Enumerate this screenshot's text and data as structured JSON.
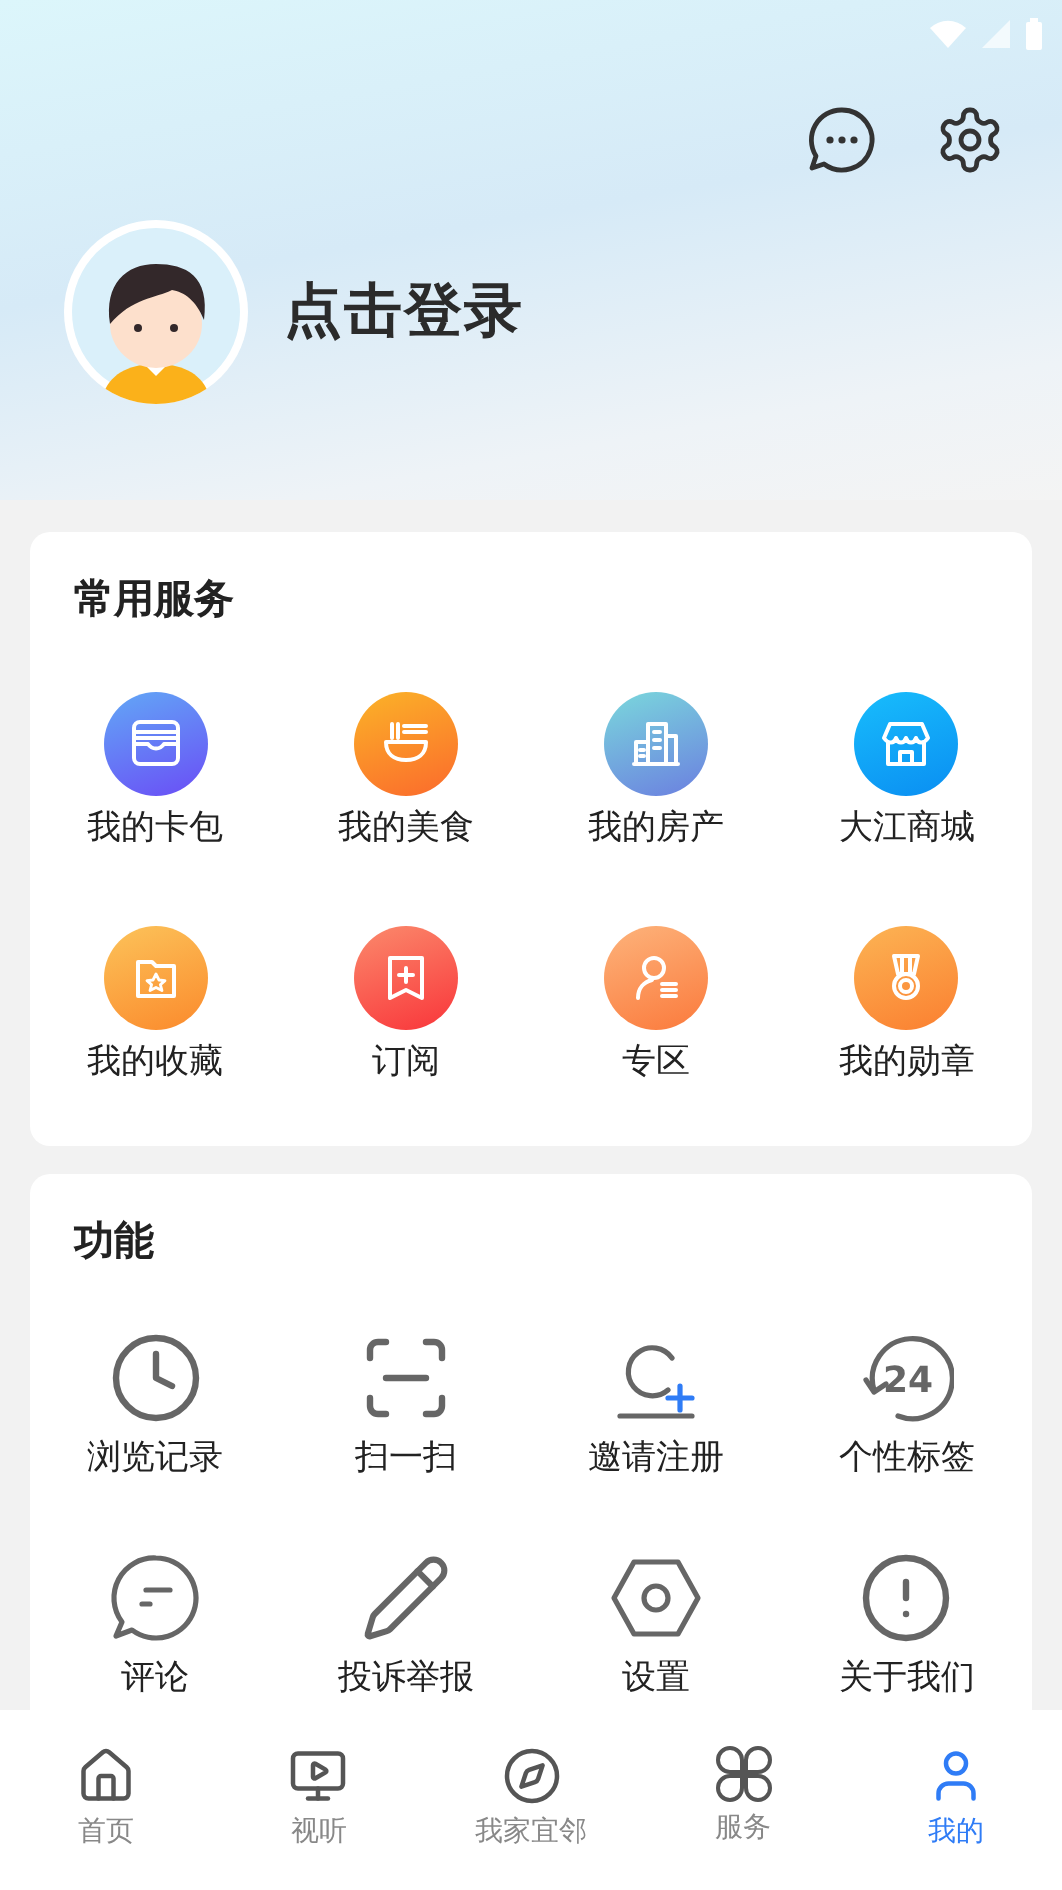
{
  "header": {
    "login_label": "点击登录"
  },
  "services": {
    "title": "常用服务",
    "items": [
      {
        "label": "我的卡包"
      },
      {
        "label": "我的美食"
      },
      {
        "label": "我的房产"
      },
      {
        "label": "大江商城"
      },
      {
        "label": "我的收藏"
      },
      {
        "label": "订阅"
      },
      {
        "label": "专区"
      },
      {
        "label": "我的勋章"
      }
    ]
  },
  "functions": {
    "title": "功能",
    "items": [
      {
        "label": "浏览记录"
      },
      {
        "label": "扫一扫"
      },
      {
        "label": "邀请注册"
      },
      {
        "label": "个性标签",
        "icon_text": "24"
      },
      {
        "label": "评论"
      },
      {
        "label": "投诉举报"
      },
      {
        "label": "设置"
      },
      {
        "label": "关于我们"
      }
    ]
  },
  "tab_bar": [
    {
      "label": "首页",
      "selected": false
    },
    {
      "label": "视听",
      "selected": false
    },
    {
      "label": "我家宜邻",
      "selected": false
    },
    {
      "label": "服务",
      "selected": false
    },
    {
      "label": "我的",
      "selected": true
    }
  ]
}
